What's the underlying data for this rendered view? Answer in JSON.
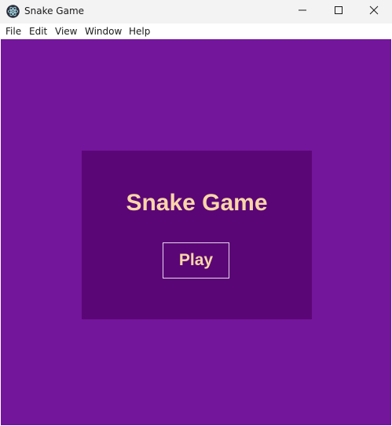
{
  "window": {
    "title": "Snake Game"
  },
  "menubar": {
    "items": [
      "File",
      "Edit",
      "View",
      "Window",
      "Help"
    ]
  },
  "game": {
    "title": "Snake Game",
    "play_label": "Play"
  },
  "colors": {
    "background": "#74169c",
    "panel": "#5b0676",
    "title_text": "#f8d6a8",
    "button_border": "#e9d7ee",
    "titlebar": "#f3f3f3"
  },
  "icons": {
    "app": "electron-app-icon",
    "minimize": "minimize-icon",
    "maximize": "maximize-icon",
    "close": "close-icon"
  }
}
